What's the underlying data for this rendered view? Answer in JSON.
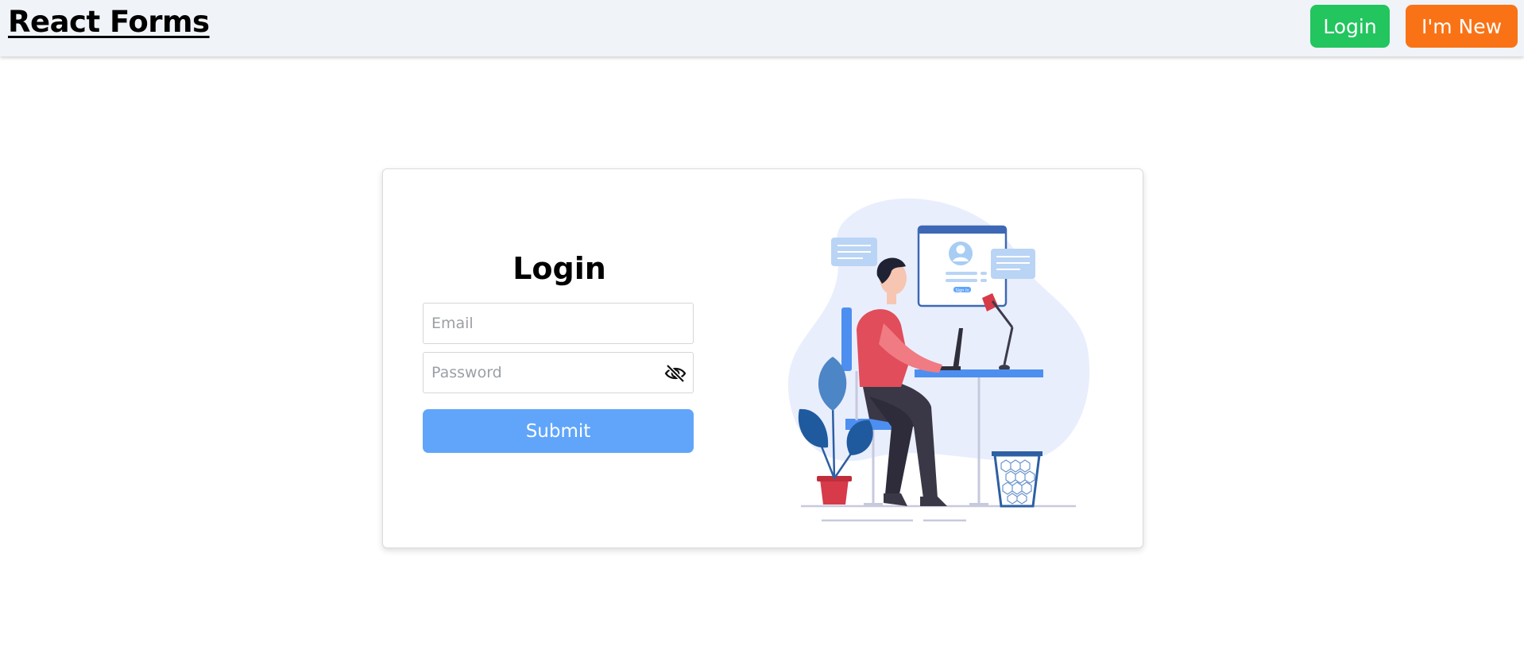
{
  "navbar": {
    "brand": "React Forms",
    "login_label": "Login",
    "new_label": "I'm New",
    "login_color": "#22c55e",
    "new_color": "#f97316"
  },
  "form": {
    "title": "Login",
    "email_placeholder": "Email",
    "password_placeholder": "Password",
    "password_toggle_icon": "eye-slash-icon",
    "submit_label": "Submit",
    "submit_color": "#60a5fa"
  },
  "illustration": {
    "description_icon": "person-at-desk-illustration",
    "screen_button_text": "Sign in"
  }
}
